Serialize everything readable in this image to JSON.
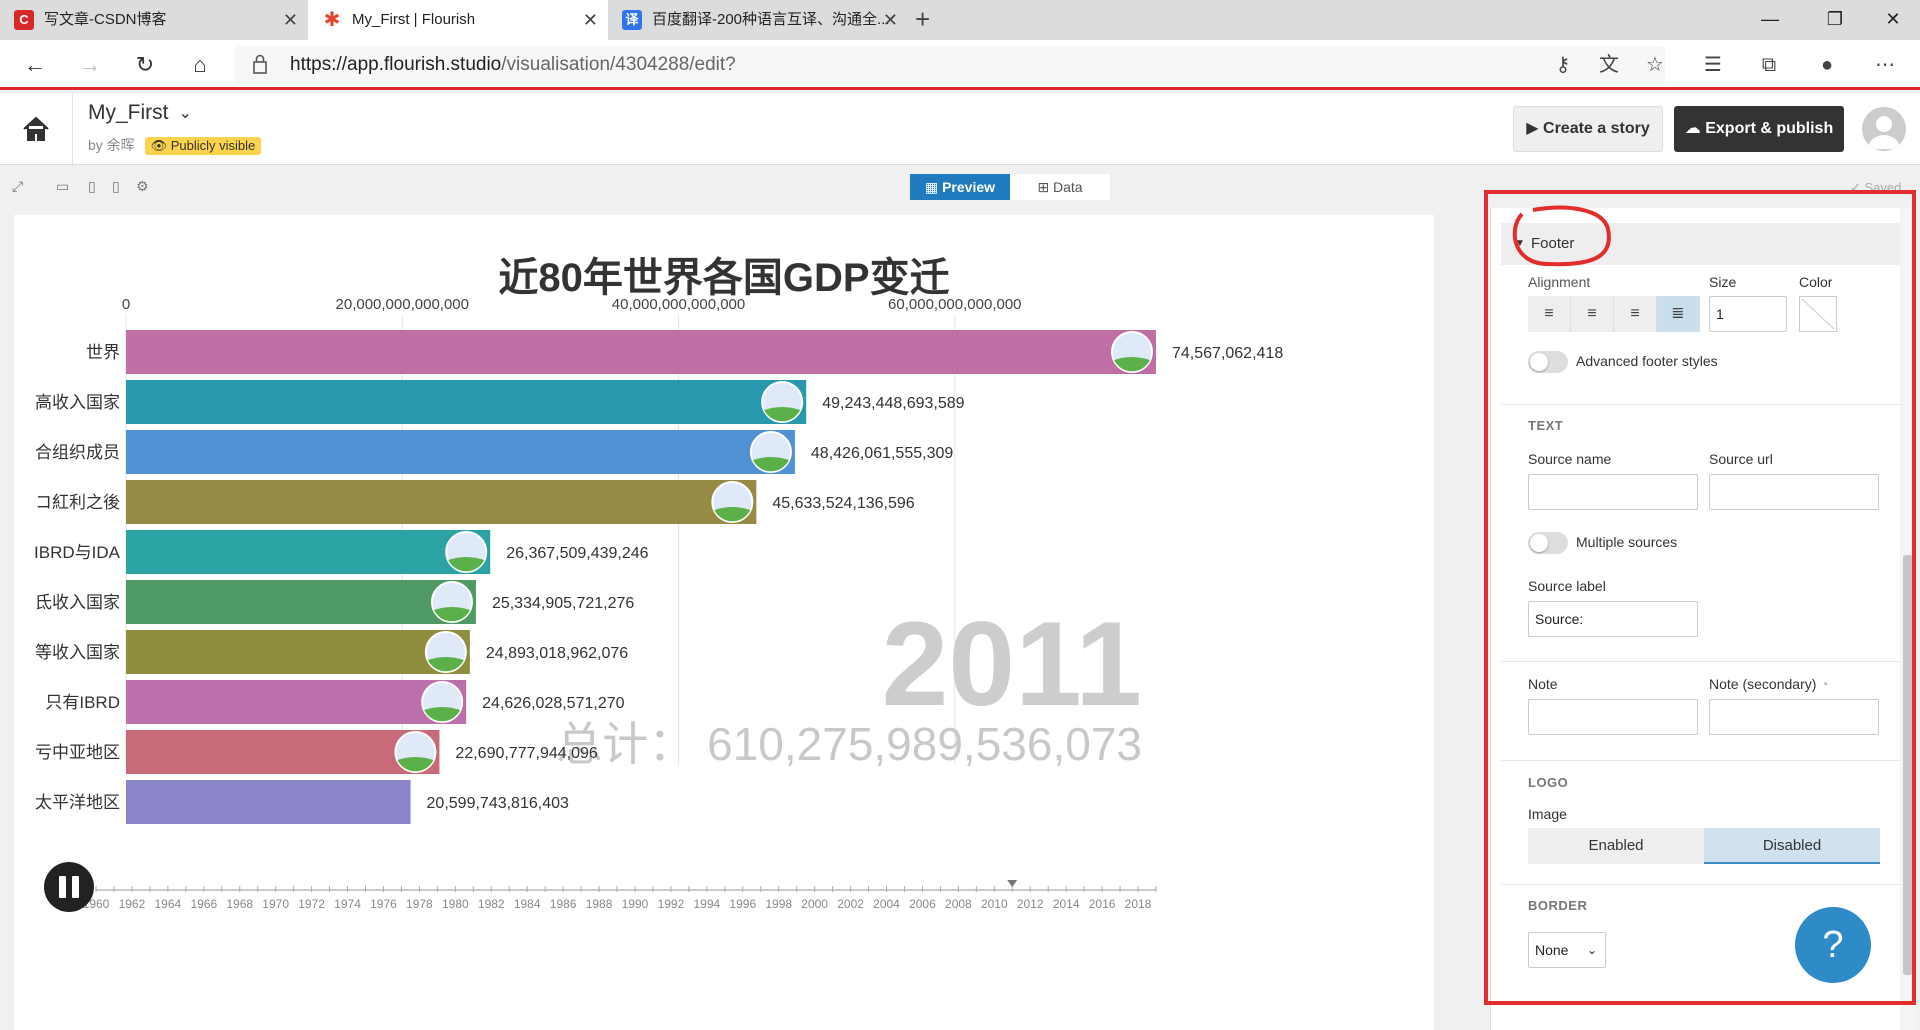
{
  "browser": {
    "tabs": [
      {
        "title": "写文章-CSDN博客",
        "favicon": "C",
        "color": "#d72a28"
      },
      {
        "title": "My_First | Flourish",
        "favicon": "✱",
        "color": "#e8452c"
      },
      {
        "title": "百度翻译-200种语言互译、沟通全...",
        "favicon": "译",
        "color": "#2e74f0"
      }
    ],
    "url_host": "https://app.flourish.studio",
    "url_path": "/visualisation/4304288/edit?"
  },
  "app": {
    "project_title": "My_First",
    "by_label": "by 余晖",
    "visibility": "Publicly visible",
    "create_story": "Create a story",
    "export_publish": "Export & publish",
    "preview_tab": "Preview",
    "data_tab": "Data",
    "saved": "Saved"
  },
  "chart_data": {
    "type": "bar",
    "title": "近80年世界各国GDP变迁",
    "x_ticks": [
      "0",
      "20,000,000,000,000",
      "40,000,000,000,000",
      "60,000,000,000,000"
    ],
    "x_tick_values": [
      0,
      20000000000000,
      40000000000000,
      60000000000000
    ],
    "xlim": [
      0,
      74567062418000
    ],
    "categories": [
      "世界",
      "高收入国家",
      "经合组织成员",
      "拉丁美洲和加勒比地区之後",
      "IBRD与IDA",
      "中低收入国家",
      "中等收入国家",
      "只有IBRD",
      "东亚与中亚地区",
      "东亚与太平洋地区"
    ],
    "category_display": [
      "世界",
      "高收入国家",
      "合组织成员",
      "コ紅利之後",
      "IBRD与IDA",
      "氐收入国家",
      "等收入国家",
      "只有IBRD",
      "亏中亚地区",
      "太平洋地区"
    ],
    "values": [
      74567062418000,
      49243448693589,
      48426061555309,
      45633524136596,
      26367509439246,
      25334905721276,
      24893018962076,
      24626028571270,
      22690777944096,
      20599743816403
    ],
    "value_labels": [
      "74,567,062,418",
      "49,243,448,693,589",
      "48,426,061,555,309",
      "45,633,524,136,596",
      "26,367,509,439,246",
      "25,334,905,721,276",
      "24,893,018,962,076",
      "24,626,028,571,270",
      "22,690,777,944,096",
      "20,599,743,816,403"
    ],
    "colors": [
      "#bf6fa3",
      "#2899ad",
      "#5092d4",
      "#968a45",
      "#2ba3a3",
      "#4f9a64",
      "#8f8e3f",
      "#bb70ac",
      "#c96a78",
      "#8a84c8"
    ],
    "year": "2011",
    "total_label": "总计：",
    "total_value": "610,275,989,536,073",
    "timeline_years": [
      "1960",
      "1962",
      "1964",
      "1966",
      "1968",
      "1970",
      "1972",
      "1974",
      "1976",
      "1978",
      "1980",
      "1982",
      "1984",
      "1986",
      "1988",
      "1990",
      "1992",
      "1994",
      "1996",
      "1998",
      "2000",
      "2002",
      "2004",
      "2006",
      "2008",
      "2010",
      "2012",
      "2014",
      "2016",
      "2018"
    ],
    "timeline_current": 2011
  },
  "panel": {
    "footer_title": "Footer",
    "alignment": "Alignment",
    "size_label": "Size",
    "size_value": "1",
    "color_label": "Color",
    "advanced_footer": "Advanced footer styles",
    "text_section": "TEXT",
    "source_name": "Source name",
    "source_url": "Source url",
    "multiple_sources": "Multiple sources",
    "source_label": "Source label",
    "source_label_value": "Source:",
    "note": "Note",
    "note_secondary": "Note (secondary)",
    "logo_section": "LOGO",
    "image_label": "Image",
    "enabled": "Enabled",
    "disabled": "Disabled",
    "border_section": "BORDER",
    "border_value": "None"
  }
}
